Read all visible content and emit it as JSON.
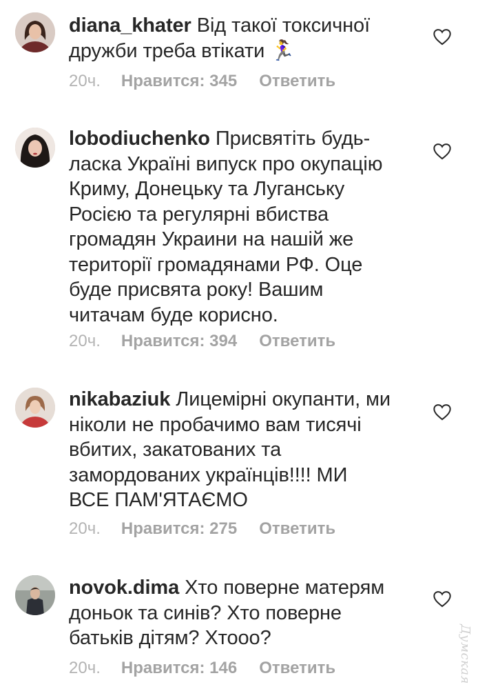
{
  "comments": [
    {
      "username": "diana_khater",
      "text": "Від такої токсичної дружби треба втікати 🏃‍♀️",
      "time": "20ч.",
      "likes": "Нравится: 345",
      "reply": "Ответить"
    },
    {
      "username": "lobodiuchenko",
      "text": "Присвятіть будь-ласка Україні випуск про окупацію Криму, Донецьку та Луганську Росією та регулярні вбиства громадян Украини на нашій же території громадянами РФ. Оце буде присвята року! Вашим читачам буде корисно.",
      "time": "20ч.",
      "likes": "Нравится: 394",
      "reply": "Ответить"
    },
    {
      "username": "nikabaziuk",
      "text": "Лицемірні окупанти, ми ніколи не пробачимо вам тисячі вбитих, закатованих та замордованих українців!!!! МИ ВСЕ ПАМ'ЯТАЄМО",
      "time": "20ч.",
      "likes": "Нравится: 275",
      "reply": "Ответить"
    },
    {
      "username": "novok.dima",
      "text": "Хто поверне матерям доньок та синів? Хто поверне батьків дітям? Хтооо?",
      "time": "20ч.",
      "likes": "Нравится: 146",
      "reply": "Ответить"
    }
  ],
  "watermark": "Думская",
  "icons": {
    "like": "heart-outline-icon"
  },
  "colors": {
    "text": "#262626",
    "meta": "#a3a3a3",
    "background": "#ffffff"
  }
}
